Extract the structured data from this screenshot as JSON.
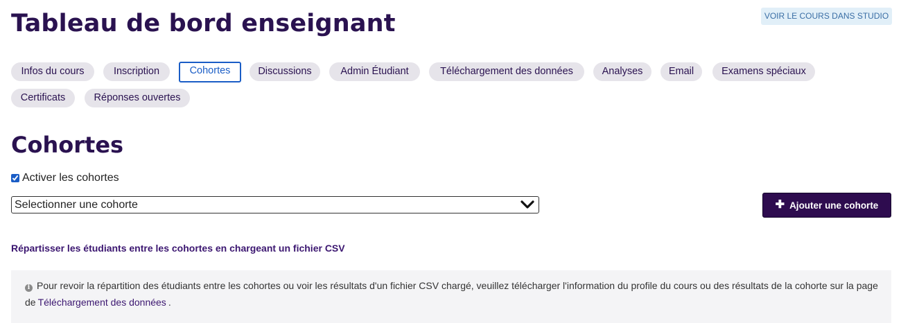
{
  "header": {
    "title": "Tableau de bord enseignant",
    "studio_button": "VOIR LE COURS DANS STUDIO"
  },
  "tabs": [
    {
      "label": "Infos du cours",
      "active": false
    },
    {
      "label": "Inscription",
      "active": false
    },
    {
      "label": "Cohortes",
      "active": true
    },
    {
      "label": "Discussions",
      "active": false
    },
    {
      "label": "Admin Étudiant",
      "active": false
    },
    {
      "label": "Téléchargement des données",
      "active": false
    },
    {
      "label": "Analyses",
      "active": false
    },
    {
      "label": "Email",
      "active": false
    },
    {
      "label": "Examens spéciaux",
      "active": false
    },
    {
      "label": "Certificats",
      "active": false
    },
    {
      "label": "Réponses ouvertes",
      "active": false
    }
  ],
  "cohorts": {
    "section_title": "Cohortes",
    "enable_label": "Activer les cohortes",
    "enable_checked": true,
    "select_value": "Selectionner une cohorte",
    "add_button": "Ajouter une cohorte",
    "csv_link": "Répartisser les étudiants entre les cohortes en chargeant un fichier CSV",
    "info": {
      "text_before": "Pour revoir la répartition des étudiants entre les cohortes ou voir les résultats d'un fichier CSV chargé, veuillez télécharger l'information du profile du cours ou des résultats de la cohorte sur la page de",
      "link": "Téléchargement des données",
      "text_after": "."
    }
  },
  "icons": {
    "info": "info-icon",
    "chevron": "chevron-down-icon",
    "plus": "plus-icon"
  },
  "colors": {
    "brand_dark": "#2a1250",
    "active_tab_border": "#1a5dc6",
    "button_bg": "#2e0c4f",
    "tab_bg": "#e6e4ea"
  }
}
